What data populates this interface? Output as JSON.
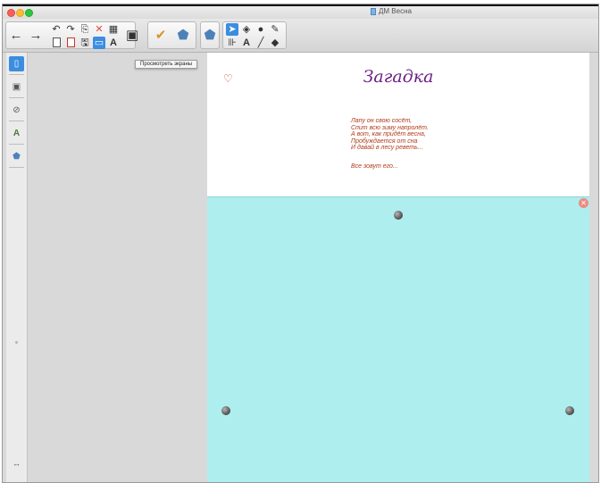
{
  "window": {
    "title": "ДМ Весна"
  },
  "toolbar": {
    "tooltip": "Просмотреть экраны",
    "icons": {
      "back": "←",
      "forward": "→",
      "undo": "↶",
      "redo": "↷",
      "clipboard": "⎘",
      "delete": "✕",
      "table": "▦",
      "doc_a": "⎙",
      "doc_b": "⎙",
      "save": "🖫",
      "screen": "▭",
      "text_format": "A",
      "screen_share": "▣",
      "check": "✔",
      "gallery": "⬟",
      "addons": "⬟",
      "select": "➤",
      "shapes": "◈",
      "fill": "●",
      "pen": "✎",
      "measure": "⊪",
      "text": "A",
      "line": "╱",
      "eraser": "◆"
    }
  },
  "sidebar": {
    "icons": {
      "pages": "▯",
      "gallery": "▣",
      "attachments": "⊘",
      "properties": "A",
      "addons": "⬟",
      "collapse": "↔"
    }
  },
  "slide": {
    "title": "Загадка",
    "poem": [
      "Лапу он свою сосёт,",
      "Спит всю зиму напролёт.",
      "А вот, как придёт весна,",
      "Пробуждается от сна",
      "И давай в лесу реветь..."
    ],
    "answer": "Все зовут его...",
    "heart_icon": "♡",
    "close_icon": "✕",
    "cover_color": "#aeeeee"
  }
}
